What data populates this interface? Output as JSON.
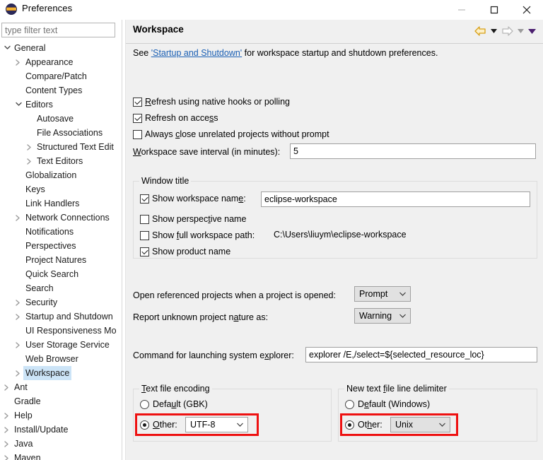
{
  "window": {
    "title": "Preferences",
    "icon": "eclipse-globe-icon",
    "minimize_label": "—",
    "maximize_label": "□",
    "close_label": "✕"
  },
  "sidebar": {
    "filter_placeholder": "type filter text",
    "filter_value": "",
    "items": [
      {
        "label": "General",
        "indent": 0,
        "arrow": "down",
        "selected": false
      },
      {
        "label": "Appearance",
        "indent": 1,
        "arrow": "right",
        "selected": false
      },
      {
        "label": "Compare/Patch",
        "indent": 1,
        "arrow": "none",
        "selected": false
      },
      {
        "label": "Content Types",
        "indent": 1,
        "arrow": "none",
        "selected": false
      },
      {
        "label": "Editors",
        "indent": 1,
        "arrow": "down",
        "selected": false
      },
      {
        "label": "Autosave",
        "indent": 2,
        "arrow": "none",
        "selected": false
      },
      {
        "label": "File Associations",
        "indent": 2,
        "arrow": "none",
        "selected": false
      },
      {
        "label": "Structured Text Edit",
        "indent": 2,
        "arrow": "right",
        "selected": false
      },
      {
        "label": "Text Editors",
        "indent": 2,
        "arrow": "right",
        "selected": false
      },
      {
        "label": "Globalization",
        "indent": 1,
        "arrow": "none",
        "selected": false
      },
      {
        "label": "Keys",
        "indent": 1,
        "arrow": "none",
        "selected": false
      },
      {
        "label": "Link Handlers",
        "indent": 1,
        "arrow": "none",
        "selected": false
      },
      {
        "label": "Network Connections",
        "indent": 1,
        "arrow": "right",
        "selected": false
      },
      {
        "label": "Notifications",
        "indent": 1,
        "arrow": "none",
        "selected": false
      },
      {
        "label": "Perspectives",
        "indent": 1,
        "arrow": "none",
        "selected": false
      },
      {
        "label": "Project Natures",
        "indent": 1,
        "arrow": "none",
        "selected": false
      },
      {
        "label": "Quick Search",
        "indent": 1,
        "arrow": "none",
        "selected": false
      },
      {
        "label": "Search",
        "indent": 1,
        "arrow": "none",
        "selected": false
      },
      {
        "label": "Security",
        "indent": 1,
        "arrow": "right",
        "selected": false
      },
      {
        "label": "Startup and Shutdown",
        "indent": 1,
        "arrow": "right",
        "selected": false
      },
      {
        "label": "UI Responsiveness Mo",
        "indent": 1,
        "arrow": "none",
        "selected": false
      },
      {
        "label": "User Storage Service",
        "indent": 1,
        "arrow": "right",
        "selected": false
      },
      {
        "label": "Web Browser",
        "indent": 1,
        "arrow": "none",
        "selected": false
      },
      {
        "label": "Workspace",
        "indent": 1,
        "arrow": "right",
        "selected": true
      },
      {
        "label": "Ant",
        "indent": 0,
        "arrow": "right",
        "selected": false
      },
      {
        "label": "Gradle",
        "indent": 0,
        "arrow": "none",
        "selected": false
      },
      {
        "label": "Help",
        "indent": 0,
        "arrow": "right",
        "selected": false
      },
      {
        "label": "Install/Update",
        "indent": 0,
        "arrow": "right",
        "selected": false
      },
      {
        "label": "Java",
        "indent": 0,
        "arrow": "right",
        "selected": false
      },
      {
        "label": "Maven",
        "indent": 0,
        "arrow": "right",
        "selected": false
      }
    ]
  },
  "page": {
    "title": "Workspace",
    "description_prefix": "See ",
    "description_link": "'Startup and Shutdown'",
    "description_suffix": " for workspace startup and shutdown preferences.",
    "nav": {
      "back": "back-arrow",
      "back_menu": "back-dropdown",
      "forward": "forward-arrow",
      "forward_menu": "forward-dropdown",
      "view_menu": "view-menu"
    },
    "checkboxes": [
      {
        "label_pre": "",
        "label_mnemonic": "R",
        "label_post": "efresh using native hooks or polling",
        "checked": true
      },
      {
        "label_pre": "Refresh on acce",
        "label_mnemonic": "s",
        "label_post": "s",
        "checked": true
      },
      {
        "label_pre": "Always ",
        "label_mnemonic": "c",
        "label_post": "lose unrelated projects without prompt",
        "checked": false
      }
    ],
    "save_interval": {
      "label_mnemonic": "W",
      "label_pre": "",
      "label_post": "orkspace save interval (in minutes):",
      "value": "5"
    },
    "window_title_group": {
      "legend": "Window title",
      "show_workspace_name": {
        "label_pre": "Show workspace nam",
        "label_mnemonic": "e",
        "label_post": ":",
        "checked": true,
        "value": "eclipse-workspace"
      },
      "show_perspective_name": {
        "label_pre": "Show perspec",
        "label_mnemonic": "t",
        "label_post": "ive name",
        "checked": false
      },
      "show_full_workspace_path": {
        "label_pre": "Show ",
        "label_mnemonic": "f",
        "label_post": "ull workspace path:",
        "checked": false,
        "path": "C:\\Users\\liuym\\eclipse-workspace"
      },
      "show_product_name": {
        "label_pre": "Show product name",
        "label_mnemonic": "",
        "label_post": "",
        "checked": true
      }
    },
    "open_referenced": {
      "label": "Open referenced projects when a project is opened:",
      "value": "Prompt"
    },
    "report_nature": {
      "label_pre": "Report unknown project n",
      "label_mnemonic": "a",
      "label_post": "ture as:",
      "value": "Warning"
    },
    "system_explorer": {
      "label_pre": "Command for launching system e",
      "label_mnemonic": "x",
      "label_post": "plorer:",
      "value": "explorer /E,/select=${selected_resource_loc}"
    },
    "text_file_encoding": {
      "legend_mnemonic": "T",
      "legend_post": "ext file encoding",
      "default_pre": "Defa",
      "default_mnemonic": "u",
      "default_post": "lt (GBK)",
      "default_selected": false,
      "other_pre": "",
      "other_mnemonic": "O",
      "other_post": "ther:",
      "other_selected": true,
      "other_value": "UTF-8"
    },
    "line_delimiter": {
      "legend_pre": "New text ",
      "legend_mnemonic": "f",
      "legend_post": "ile line delimiter",
      "default_pre": "D",
      "default_mnemonic": "e",
      "default_post": "fault (Windows)",
      "default_selected": false,
      "other_pre": "Ot",
      "other_mnemonic": "h",
      "other_post": "er:",
      "other_selected": true,
      "other_value": "Unix"
    }
  },
  "colors": {
    "accent_selection": "#cce4f7",
    "link": "#1a5fb4",
    "annotation_red": "#ee1111",
    "panel_bg": "#f0f0f0",
    "nav_back": "#e8a317"
  }
}
